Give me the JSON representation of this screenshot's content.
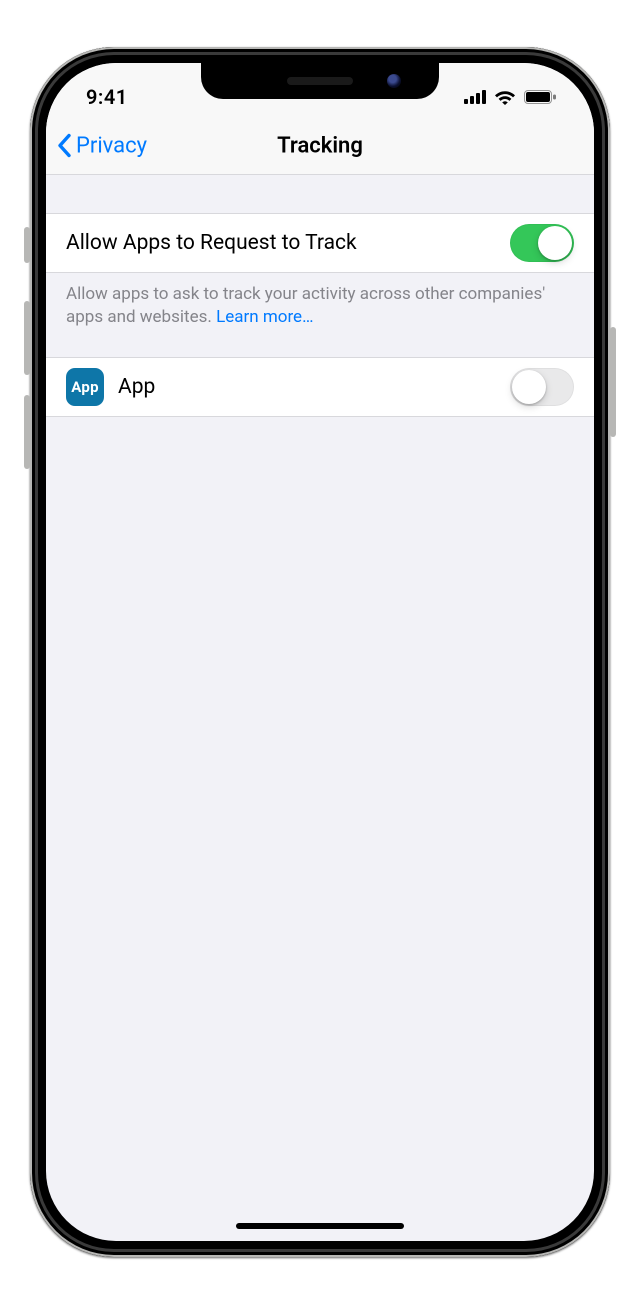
{
  "status": {
    "time": "9:41"
  },
  "nav": {
    "back_label": "Privacy",
    "title": "Tracking"
  },
  "settings": {
    "allow_label": "Allow Apps to Request to Track",
    "allow_on": true,
    "footer_text": "Allow apps to ask to track your activity across other companies' apps and websites. ",
    "learn_more": "Learn more…"
  },
  "apps": [
    {
      "icon_text": "App",
      "name": "App",
      "on": false
    }
  ]
}
